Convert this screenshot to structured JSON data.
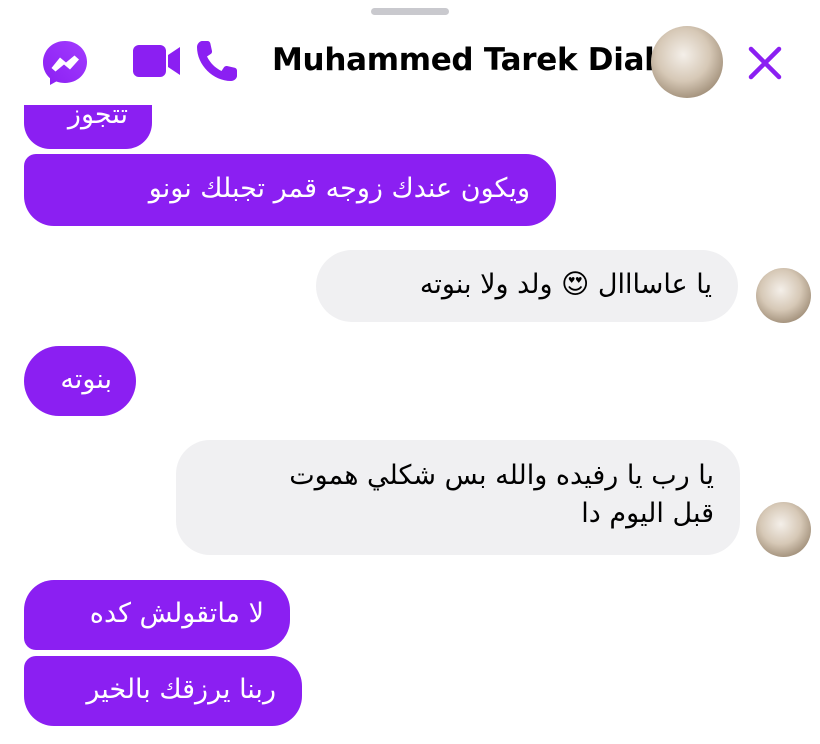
{
  "header": {
    "contact_name": "Muhammed Tarek Diab",
    "icons": [
      "messenger-icon",
      "video-call-icon",
      "phone-call-icon",
      "close-icon"
    ],
    "accent_color": "#8b1ff2"
  },
  "messages": [
    {
      "direction": "outgoing",
      "text": "تتجوز"
    },
    {
      "direction": "outgoing",
      "text": "ويكون عندك زوجه قمر تجبلك نونو"
    },
    {
      "direction": "incoming",
      "text": "يا عاسااال 😍 ولد ولا بنوته"
    },
    {
      "direction": "outgoing",
      "text": "بنوته"
    },
    {
      "direction": "incoming",
      "text_line1": "يا رب يا رفيده والله بس شكلي هموت",
      "text_line2": "قبل اليوم دا"
    },
    {
      "direction": "outgoing",
      "text": "لا ماتقولش كده"
    },
    {
      "direction": "outgoing",
      "text": "ربنا يرزقك بالخير"
    }
  ]
}
